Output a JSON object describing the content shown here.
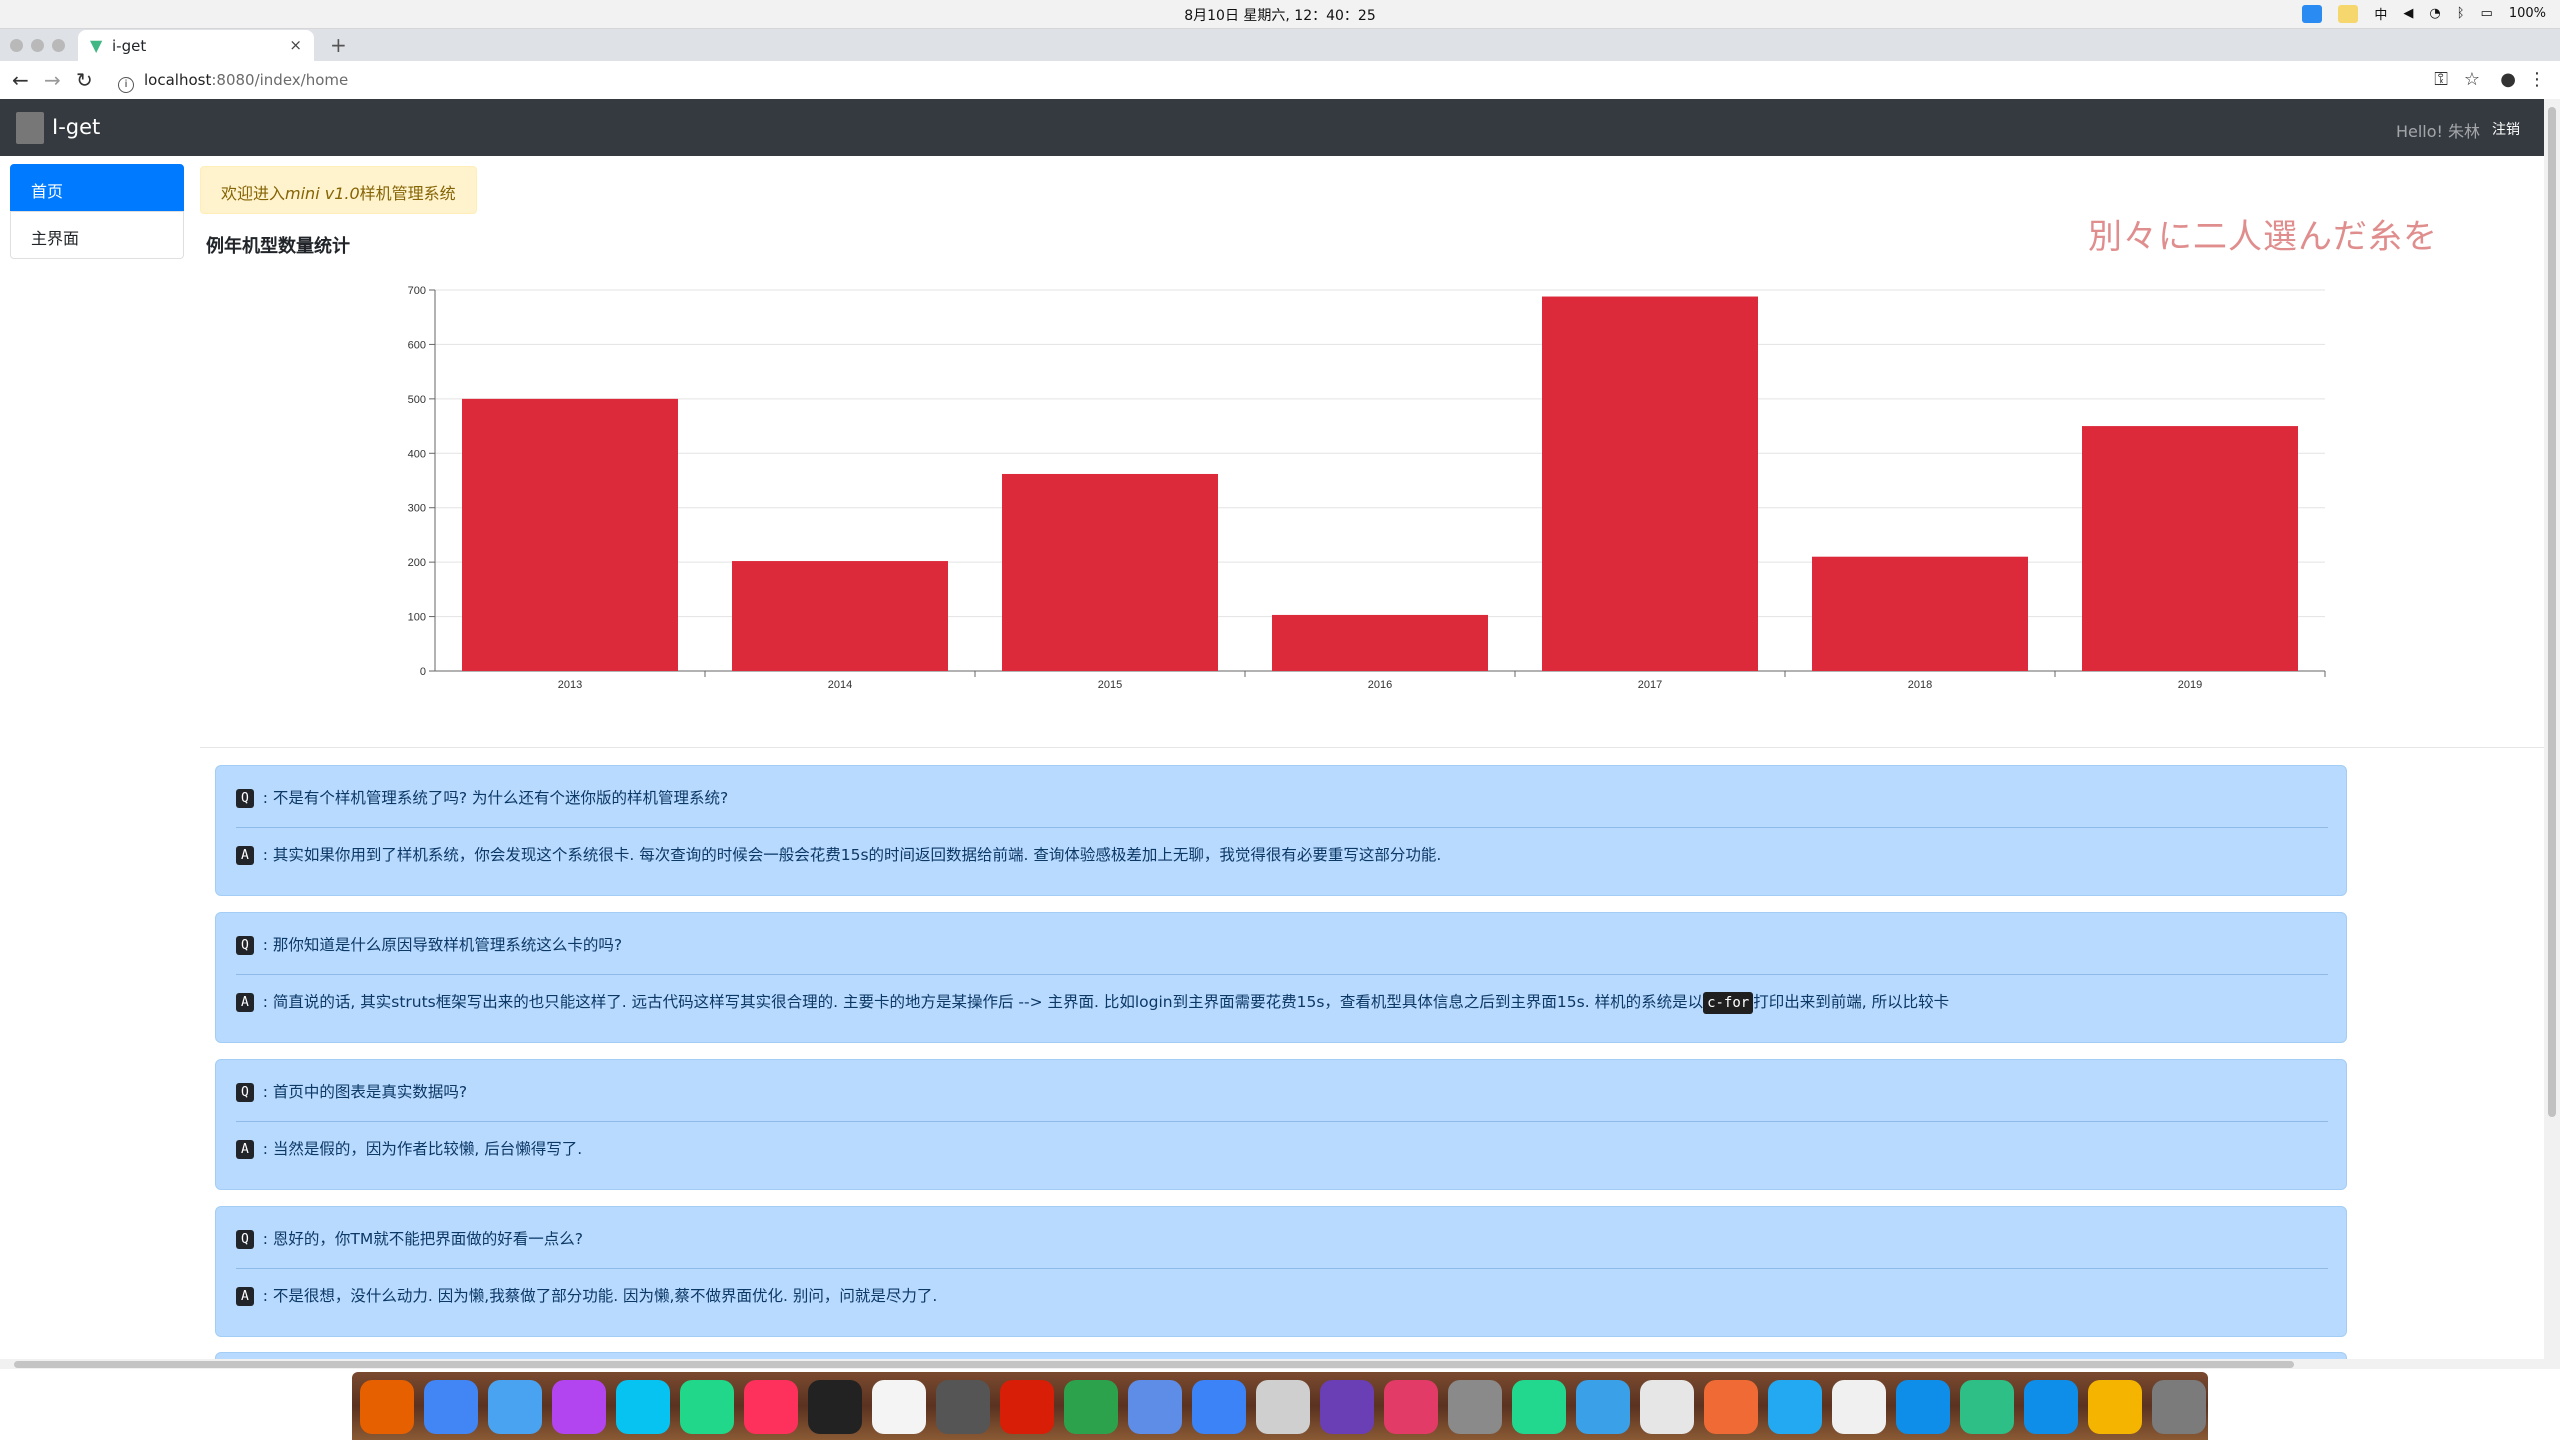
{
  "menubar": {
    "clock": "8月10日 星期六, 12：40：25",
    "battery": "100%",
    "input_method": "中"
  },
  "browser": {
    "tab_title": "i-get",
    "tab_close": "×",
    "new_tab": "+",
    "url_host": "localhost",
    "url_rest": ":8080/index/home",
    "info_icon_glyph": "i"
  },
  "app": {
    "brand": "I-get",
    "hello": "Hello!  朱林",
    "logout": "注销"
  },
  "sidebar": {
    "items": [
      {
        "label": "首页",
        "active": true
      },
      {
        "label": "主界面",
        "active": false
      }
    ]
  },
  "welcome": {
    "prefix": "欢迎进入",
    "emphasis": "mini v1.0",
    "suffix": "样机管理系统"
  },
  "stat_title": "例年机型数量统计",
  "overlay_text": "別々に二人選んだ糸を",
  "chart_data": {
    "type": "bar",
    "categories": [
      "2013",
      "2014",
      "2015",
      "2016",
      "2017",
      "2018",
      "2019"
    ],
    "values": [
      500,
      202,
      362,
      103,
      688,
      210,
      450
    ],
    "ylim": [
      0,
      700
    ],
    "yticks": [
      0,
      100,
      200,
      300,
      400,
      500,
      600,
      700
    ],
    "grid": true,
    "bar_color": "#dc2a3a",
    "title": "",
    "xlabel": "",
    "ylabel": ""
  },
  "faq": [
    {
      "q": "不是有个样机管理系统了吗? 为什么还有个迷你版的样机管理系统?",
      "a": "其实如果你用到了样机系统，你会发现这个系统很卡. 每次查询的时候会一般会花费15s的时间返回数据给前端. 查询体验感极差加上无聊，我觉得很有必要重写这部分功能."
    },
    {
      "q": "那你知道是什么原因导致样机管理系统这么卡的吗?",
      "a_pre": "简直说的话, 其实struts框架写出来的也只能这样了. 远古代码这样写其实很合理的. 主要卡的地方是某操作后 --> 主界面. 比如login到主界面需要花费15s，查看机型具体信息之后到主界面15s. 样机的系统是以",
      "a_code": "c-for",
      "a_post": "打印出来到前端, 所以比较卡"
    },
    {
      "q": "首页中的图表是真实数据吗?",
      "a": "当然是假的，因为作者比较懒, 后台懒得写了."
    },
    {
      "q": "恩好的，你TM就不能把界面做的好看一点么?",
      "a": "不是很想，没什么动力. 因为懒,我蔡做了部分功能. 因为懒,蔡不做界面优化. 别问，问就是尽力了."
    }
  ],
  "badges": {
    "q": "Q",
    "a": "A",
    "sep": " : "
  },
  "dock": {
    "apps": [
      "firefox-icon",
      "chrome-icon",
      "finder-icon",
      "phpstorm-icon",
      "webstorm-icon",
      "pycharm-icon",
      "intellij-icon",
      "terminal-icon",
      "textedit-icon",
      "scripteditor-icon",
      "netease-music-icon",
      "numbers-icon",
      "launchpad-icon",
      "keynote-icon",
      "preview-icon",
      "instastats-icon",
      "flow-icon",
      "system-prefs-icon",
      "datagrip-icon",
      "mysql-workbench-icon",
      "font-book-icon",
      "paw-icon",
      "vscode-icon",
      "typora-icon",
      "teamviewer-icon",
      "infuse-icon",
      "teamviewer2-icon",
      "screens-icon",
      "rocket-icon"
    ],
    "colors": [
      "#e66000",
      "#4285f4",
      "#4aa3f0",
      "#b345f1",
      "#07c3f2",
      "#21d789",
      "#fe315d",
      "#222222",
      "#f4f4f4",
      "#555555",
      "#d81e06",
      "#2ca24c",
      "#5e8de8",
      "#3b83f7",
      "#cfcfcf",
      "#6a3fb5",
      "#e33b67",
      "#8a8a8a",
      "#22d88f",
      "#3aa0e8",
      "#e6e6e6",
      "#f06a35",
      "#23a9f2",
      "#f0f0f0",
      "#0e8ee9",
      "#2dbf85",
      "#0e8ee9",
      "#f4b400",
      "#7b7b7b"
    ]
  }
}
